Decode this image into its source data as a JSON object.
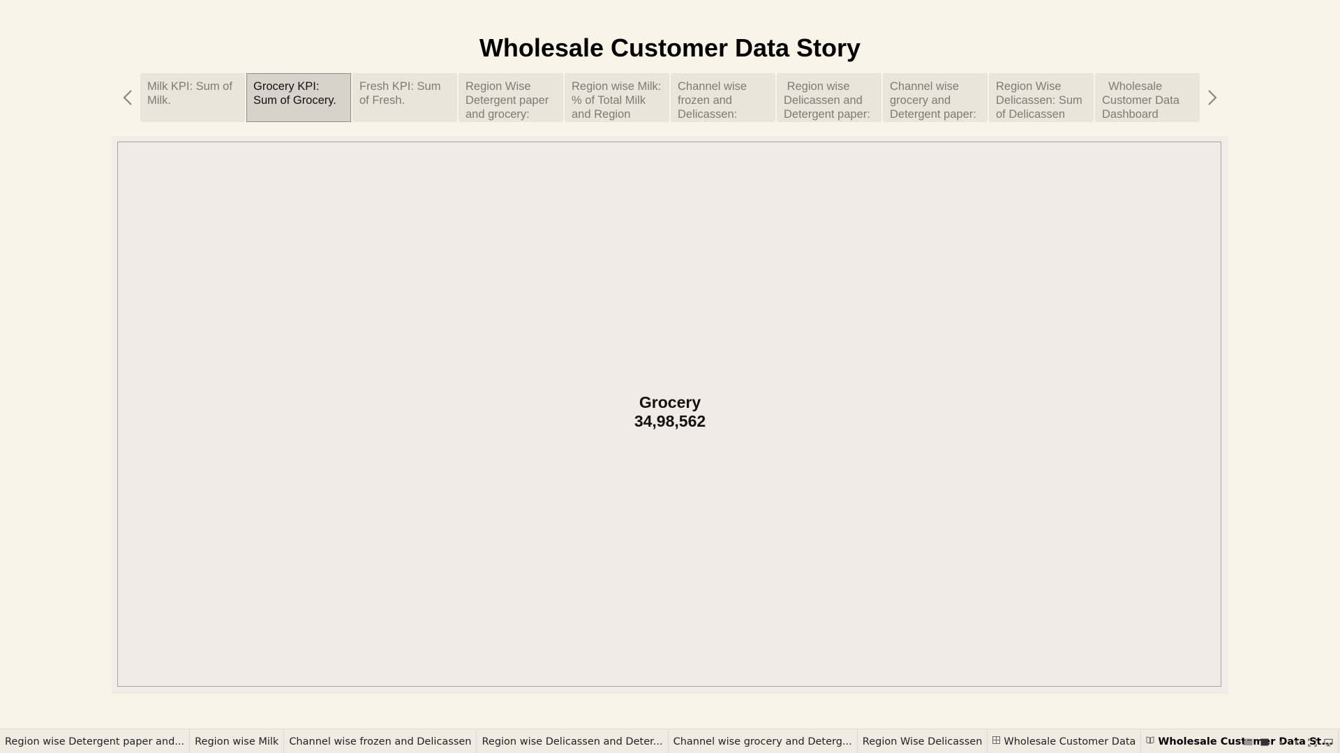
{
  "story": {
    "title": "Wholesale Customer Data Story"
  },
  "story_points": [
    {
      "label": "Milk KPI: Sum of Milk."
    },
    {
      "label": "Grocery KPI: Sum of Grocery."
    },
    {
      "label": "Fresh KPI: Sum of Fresh."
    },
    {
      "label": "Region Wise Detergent paper and grocery:"
    },
    {
      "label": "Region wise Milk: % of Total Milk and Region"
    },
    {
      "label": "Channel wise frozen and Delicassen:"
    },
    {
      "label": " Region wise Delicassen and Detergent paper:"
    },
    {
      "label": "Channel wise grocery and Detergent paper:"
    },
    {
      "label": "Region Wise Delicassen: Sum of Delicassen"
    },
    {
      "label": "  Wholesale Customer Data Dashboard"
    }
  ],
  "active_story_point": 1,
  "kpi": {
    "label": "Grocery",
    "value": "34,98,562"
  },
  "sheet_tabs": [
    {
      "label": "Region wise Detergent paper and...",
      "icon": ""
    },
    {
      "label": "Region wise Milk",
      "icon": ""
    },
    {
      "label": "Channel wise frozen and Delicassen",
      "icon": ""
    },
    {
      "label": "Region wise Delicassen and Deter...",
      "icon": ""
    },
    {
      "label": "Channel wise grocery and Deterg...",
      "icon": ""
    },
    {
      "label": "Region Wise Delicassen",
      "icon": ""
    },
    {
      "label": "Wholesale Customer Data",
      "icon": "dashboard-icon"
    },
    {
      "label": "Wholesale Customer Data St...",
      "icon": "story-icon"
    }
  ],
  "active_sheet_tab": 7,
  "colors": {
    "background": "#faf3e8",
    "story_point_bg": "#ebe4da",
    "story_point_active_bg": "#d7d2ca",
    "canvas_bg": "#f0ebe7"
  }
}
